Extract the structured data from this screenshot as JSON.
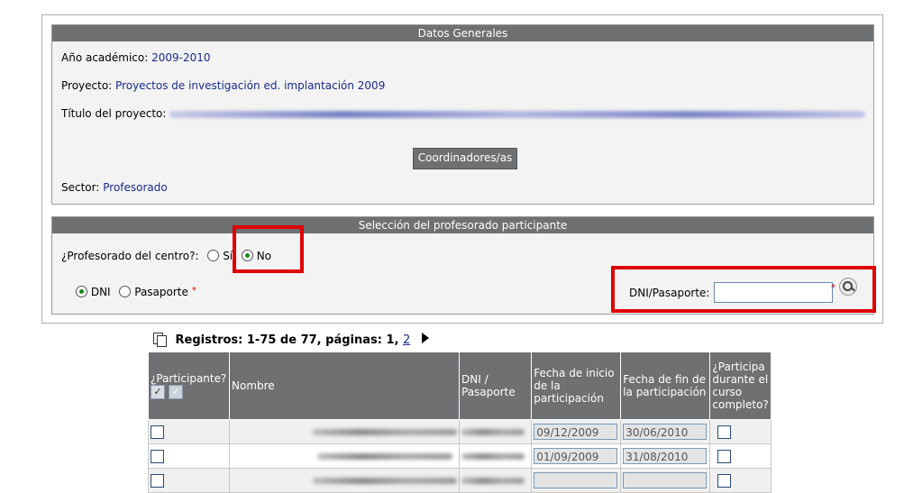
{
  "datos_generales": {
    "title": "Datos Generales",
    "anio_label": "Año académico:",
    "anio_value": "2009-2010",
    "proyecto_label": "Proyecto:",
    "proyecto_value": "Proyectos de investigación ed. implantación 2009",
    "titulo_label": "Título del proyecto:",
    "coordinadores_button": "Coordinadores/as",
    "sector_label": "Sector:",
    "sector_value": "Profesorado"
  },
  "seleccion": {
    "title": "Selección del profesorado participante",
    "centro_question": "¿Profesorado del centro?:",
    "option_si": "Sí",
    "option_no": "No",
    "selected": "No",
    "doc_dni": "DNI",
    "doc_pasaporte": "Pasaporte",
    "doc_selected": "DNI",
    "required_mark": "*",
    "dni_label": "DNI/Pasaporte:",
    "dni_value": ""
  },
  "registros": {
    "text": "Registros: 1-75 de 77, páginas: 1,",
    "page_link": "2"
  },
  "table": {
    "headers": {
      "participante": "¿Participante?",
      "nombre": "Nombre",
      "dni": "DNI / Pasaporte",
      "fecha_inicio": "Fecha de inicio de la participación",
      "fecha_fin": "Fecha de fin de la participación",
      "curso_completo": "¿Participa durante el curso completo?"
    },
    "rows": [
      {
        "fecha_inicio": "09/12/2009",
        "fecha_fin": "30/06/2010"
      },
      {
        "fecha_inicio": "01/09/2009",
        "fecha_fin": "31/08/2010"
      },
      {
        "fecha_inicio": "",
        "fecha_fin": ""
      }
    ]
  },
  "colors": {
    "header_bg": "#6e7072",
    "link": "#1a2a8a",
    "highlight": "#e00000"
  }
}
